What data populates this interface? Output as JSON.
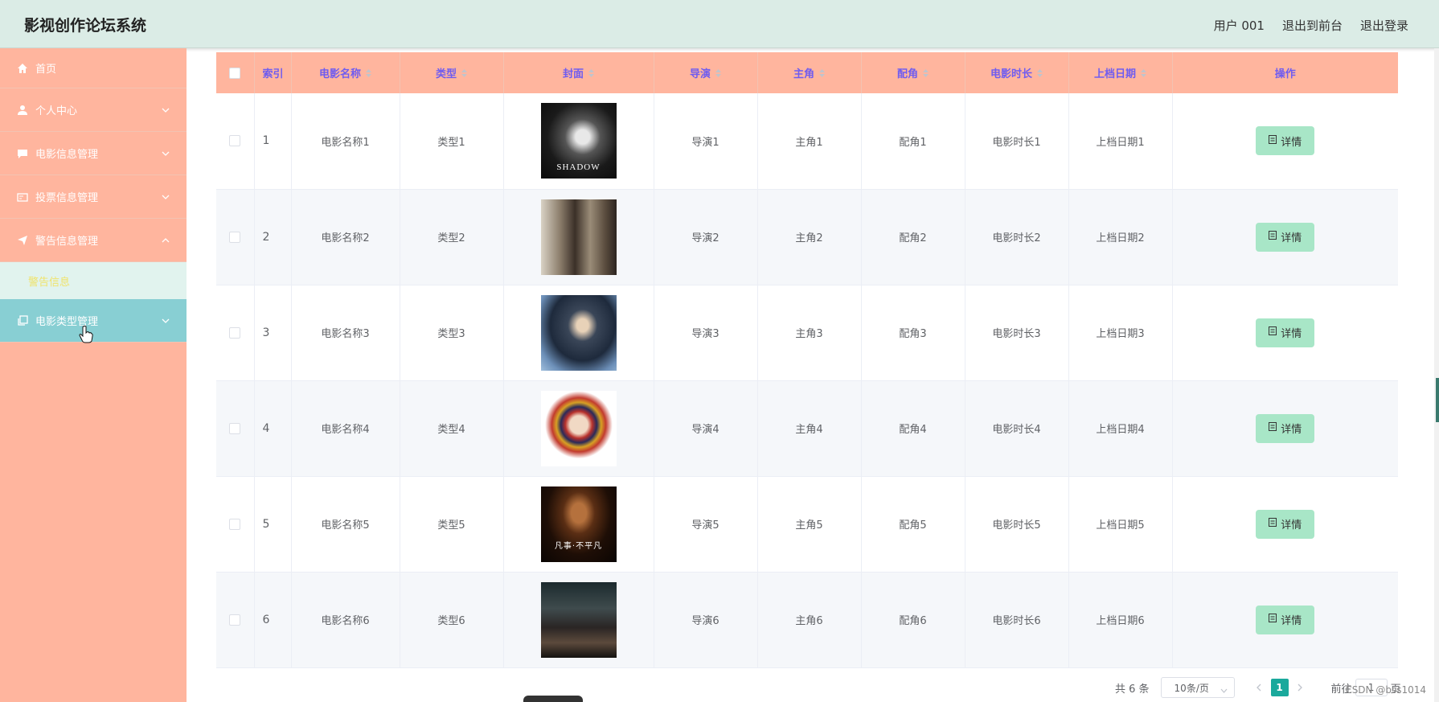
{
  "header": {
    "title": "影视创作论坛系统",
    "user": "用户 001",
    "to_front": "退出到前台",
    "logout": "退出登录"
  },
  "sidebar": {
    "items": [
      {
        "label": "首页",
        "icon": "home-icon"
      },
      {
        "label": "个人中心",
        "icon": "user-icon"
      },
      {
        "label": "电影信息管理",
        "icon": "chat-icon"
      },
      {
        "label": "投票信息管理",
        "icon": "card-icon"
      },
      {
        "label": "警告信息管理",
        "icon": "send-icon"
      },
      {
        "label": "电影类型管理",
        "icon": "copy-icon"
      }
    ],
    "submenu_label": "警告信息"
  },
  "table": {
    "columns": [
      "索引",
      "电影名称",
      "类型",
      "封面",
      "导演",
      "主角",
      "配角",
      "电影时长",
      "上档日期",
      "操作"
    ],
    "rows": [
      {
        "index": "1",
        "name": "电影名称1",
        "type": "类型1",
        "cover_text": "SHADOW",
        "director": "导演1",
        "lead": "主角1",
        "support": "配角1",
        "duration": "电影时长1",
        "date": "上档日期1"
      },
      {
        "index": "2",
        "name": "电影名称2",
        "type": "类型2",
        "cover_text": "",
        "director": "导演2",
        "lead": "主角2",
        "support": "配角2",
        "duration": "电影时长2",
        "date": "上档日期2"
      },
      {
        "index": "3",
        "name": "电影名称3",
        "type": "类型3",
        "cover_text": "",
        "director": "导演3",
        "lead": "主角3",
        "support": "配角3",
        "duration": "电影时长3",
        "date": "上档日期3"
      },
      {
        "index": "4",
        "name": "电影名称4",
        "type": "类型4",
        "cover_text": "",
        "director": "导演4",
        "lead": "主角4",
        "support": "配角4",
        "duration": "电影时长4",
        "date": "上档日期4"
      },
      {
        "index": "5",
        "name": "电影名称5",
        "type": "类型5",
        "cover_text": "凡事·不平凡",
        "director": "导演5",
        "lead": "主角5",
        "support": "配角5",
        "duration": "电影时长5",
        "date": "上档日期5"
      },
      {
        "index": "6",
        "name": "电影名称6",
        "type": "类型6",
        "cover_text": "",
        "director": "导演6",
        "lead": "主角6",
        "support": "配角6",
        "duration": "电影时长6",
        "date": "上档日期6"
      }
    ],
    "detail_label": "详情"
  },
  "pagination": {
    "total": "共 6 条",
    "page_size": "10条/页",
    "current_page": "1",
    "goto_label": "前往",
    "goto_value": "1",
    "page_suffix": "页"
  },
  "watermark": "CSDN @bss1014",
  "colors": {
    "header_bg": "#dbece6",
    "sidebar_bg": "#ffb59e",
    "active_menu_bg": "#88cfd3",
    "table_header_bg": "#ffb59e",
    "header_text": "#6f5cf0",
    "detail_button": "#a8e6c7",
    "page_active": "#1aa99c"
  }
}
